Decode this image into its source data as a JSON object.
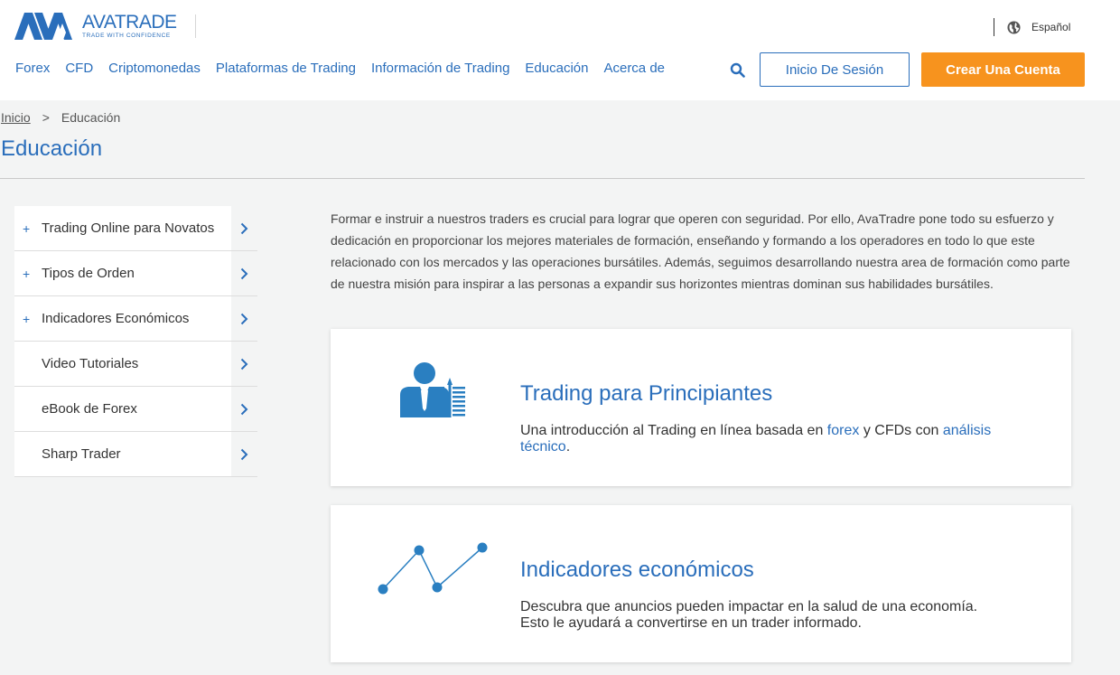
{
  "header": {
    "logo": {
      "name": "AVATRADE",
      "tagline": "TRADE WITH CONFIDENCE"
    },
    "language": {
      "label": "Español",
      "icon": "globe-icon"
    },
    "nav": [
      {
        "label": "Forex"
      },
      {
        "label": "CFD"
      },
      {
        "label": "Criptomonedas"
      },
      {
        "label": "Plataformas de Trading"
      },
      {
        "label": "Información de Trading"
      },
      {
        "label": "Educación"
      },
      {
        "label": "Acerca de"
      }
    ],
    "search_icon": "search-icon",
    "login_label": "Inicio De Sesión",
    "create_label": "Crear Una Cuenta"
  },
  "breadcrumb": {
    "home": "Inicio",
    "separator": ">",
    "current": "Educación"
  },
  "page_title": "Educación",
  "sidebar": {
    "items": [
      {
        "label": "Trading Online para Novatos",
        "expand": "+"
      },
      {
        "label": "Tipos de Orden",
        "expand": "+"
      },
      {
        "label": "Indicadores Económicos",
        "expand": "+"
      },
      {
        "label": "Video Tutoriales",
        "expand": ""
      },
      {
        "label": "eBook de Forex",
        "expand": ""
      },
      {
        "label": "Sharp Trader",
        "expand": ""
      }
    ]
  },
  "intro": "Formar e instruir a nuestros traders es crucial para lograr que operen con seguridad. Por ello, AvaTradre pone todo su esfuerzo y dedicación en proporcionar los mejores materiales de formación, enseñando y formando a los operadores en todo lo que este relacionado con los mercados y las operaciones bursátiles. Además, seguimos desarrollando nuestra area de formación como parte de nuestra misión para inspirar a las personas a expandir sus horizontes mientras dominan sus habilidades bursátiles.",
  "cards": [
    {
      "title": "Trading para Principiantes",
      "icon": "trader-growth-icon",
      "desc_1": "Una introducción al Trading en línea basada en ",
      "link_1": "forex",
      "desc_2": " y CFDs con ",
      "link_2": "análisis técnico",
      "desc_3": "."
    },
    {
      "title": "Indicadores económicos",
      "icon": "line-chart-icon",
      "desc_line_1": "Descubra que anuncios pueden impactar en la salud de una economía.",
      "desc_line_2": "Esto le ayudará a convertirse en un trader informado."
    }
  ],
  "colors": {
    "brand_blue": "#2a6ebb",
    "accent_orange": "#f7931e",
    "background": "#f3f4f4"
  }
}
